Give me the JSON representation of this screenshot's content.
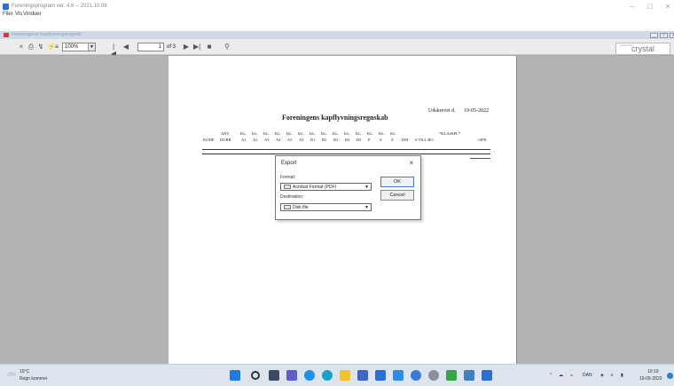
{
  "window": {
    "title": "Foreningsprogram ver. 4.6 -- 2021.10.08",
    "minimize": "–",
    "maximize": "□",
    "close": "×"
  },
  "menu": [
    "Filer",
    "Vis",
    "Vinduer"
  ],
  "crystal_window": {
    "title": "Foreningens kapflyvningsregnsk"
  },
  "toolbar": {
    "zoom": "100%",
    "page_current": "1",
    "page_total": "of 3",
    "logo": "crystal",
    "logo_small": "powered by"
  },
  "report": {
    "date_label": "Udskrevet d.",
    "date": "19-05-2022",
    "title": "Foreningens kapflyvningsregnskab",
    "header_row1": [
      "",
      "ANT.",
      "KL.",
      "KL.",
      "KL.",
      "KL.",
      "KL.",
      "KL.",
      "KL.",
      "KL.",
      "KL.",
      "KL.",
      "KL.",
      "KL.",
      "KL.",
      "KL.",
      "",
      "*KLASSPL*",
      ""
    ],
    "header_row2": [
      "KODE",
      "DUBB",
      "A1",
      "A2",
      "A3",
      "A4",
      "A5",
      "A5",
      "B1",
      "B2",
      "B3",
      "B4",
      "B5",
      "P",
      "S",
      "Z",
      "DM",
      "S   TILL.BO",
      "+SPE."
    ]
  },
  "dialog": {
    "title": "Export",
    "close": "×",
    "format_label": "Format:",
    "format_value": "Acrobat Format (PDF)",
    "destination_label": "Destination:",
    "destination_value": "Disk file",
    "ok_label": "OK",
    "cancel_label": "Cancel"
  },
  "taskbar": {
    "temperature": "15°C",
    "weather": "Regn kommer",
    "language": "DAN",
    "time": "10:19",
    "date": "19-05-2022"
  }
}
